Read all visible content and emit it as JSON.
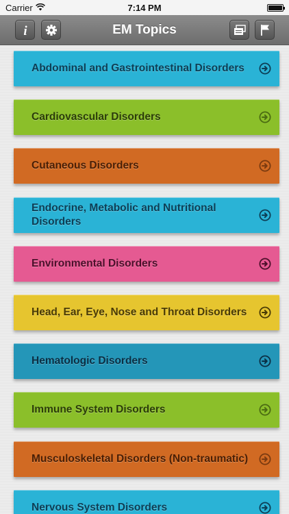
{
  "status_bar": {
    "carrier": "Carrier",
    "time": "7:14 PM"
  },
  "nav": {
    "title": "EM Topics",
    "icons": [
      "info-icon",
      "gear-icon",
      "flashcards-icon",
      "flag-icon"
    ]
  },
  "topics": [
    {
      "label": "Abdominal and Gastrointestinal Disorders",
      "bg": "#2ab3d6",
      "text": "#0d3e55",
      "arrow": "#0d3e55"
    },
    {
      "label": "Cardiovascular Disorders",
      "bg": "#8bbf2a",
      "text": "#2b3d08",
      "arrow": "#4b6b12"
    },
    {
      "label": "Cutaneous Disorders",
      "bg": "#d16a23",
      "text": "#4a1f05",
      "arrow": "#7a3a10"
    },
    {
      "label": "Endocrine, Metabolic and Nutritional Disorders",
      "bg": "#2ab3d6",
      "text": "#0d3e55",
      "arrow": "#0d3e55"
    },
    {
      "label": "Environmental Disorders",
      "bg": "#e55a92",
      "text": "#4b0f2a",
      "arrow": "#4b0f2a"
    },
    {
      "label": "Head, Ear, Eye, Nose and Throat Disorders",
      "bg": "#e6c52f",
      "text": "#4a3b05",
      "arrow": "#4a3b05"
    },
    {
      "label": "Hematologic Disorders",
      "bg": "#2496b8",
      "text": "#0b2f44",
      "arrow": "#0b2f44"
    },
    {
      "label": "Immune System Disorders",
      "bg": "#8bbf2a",
      "text": "#2b3d08",
      "arrow": "#4b6b12"
    },
    {
      "label": "Musculoskeletal Disorders (Non-traumatic)",
      "bg": "#d16a23",
      "text": "#4a1f05",
      "arrow": "#7a3a10"
    },
    {
      "label": "Nervous System Disorders",
      "bg": "#2ab3d6",
      "text": "#0d3e55",
      "arrow": "#0d3e55"
    }
  ]
}
